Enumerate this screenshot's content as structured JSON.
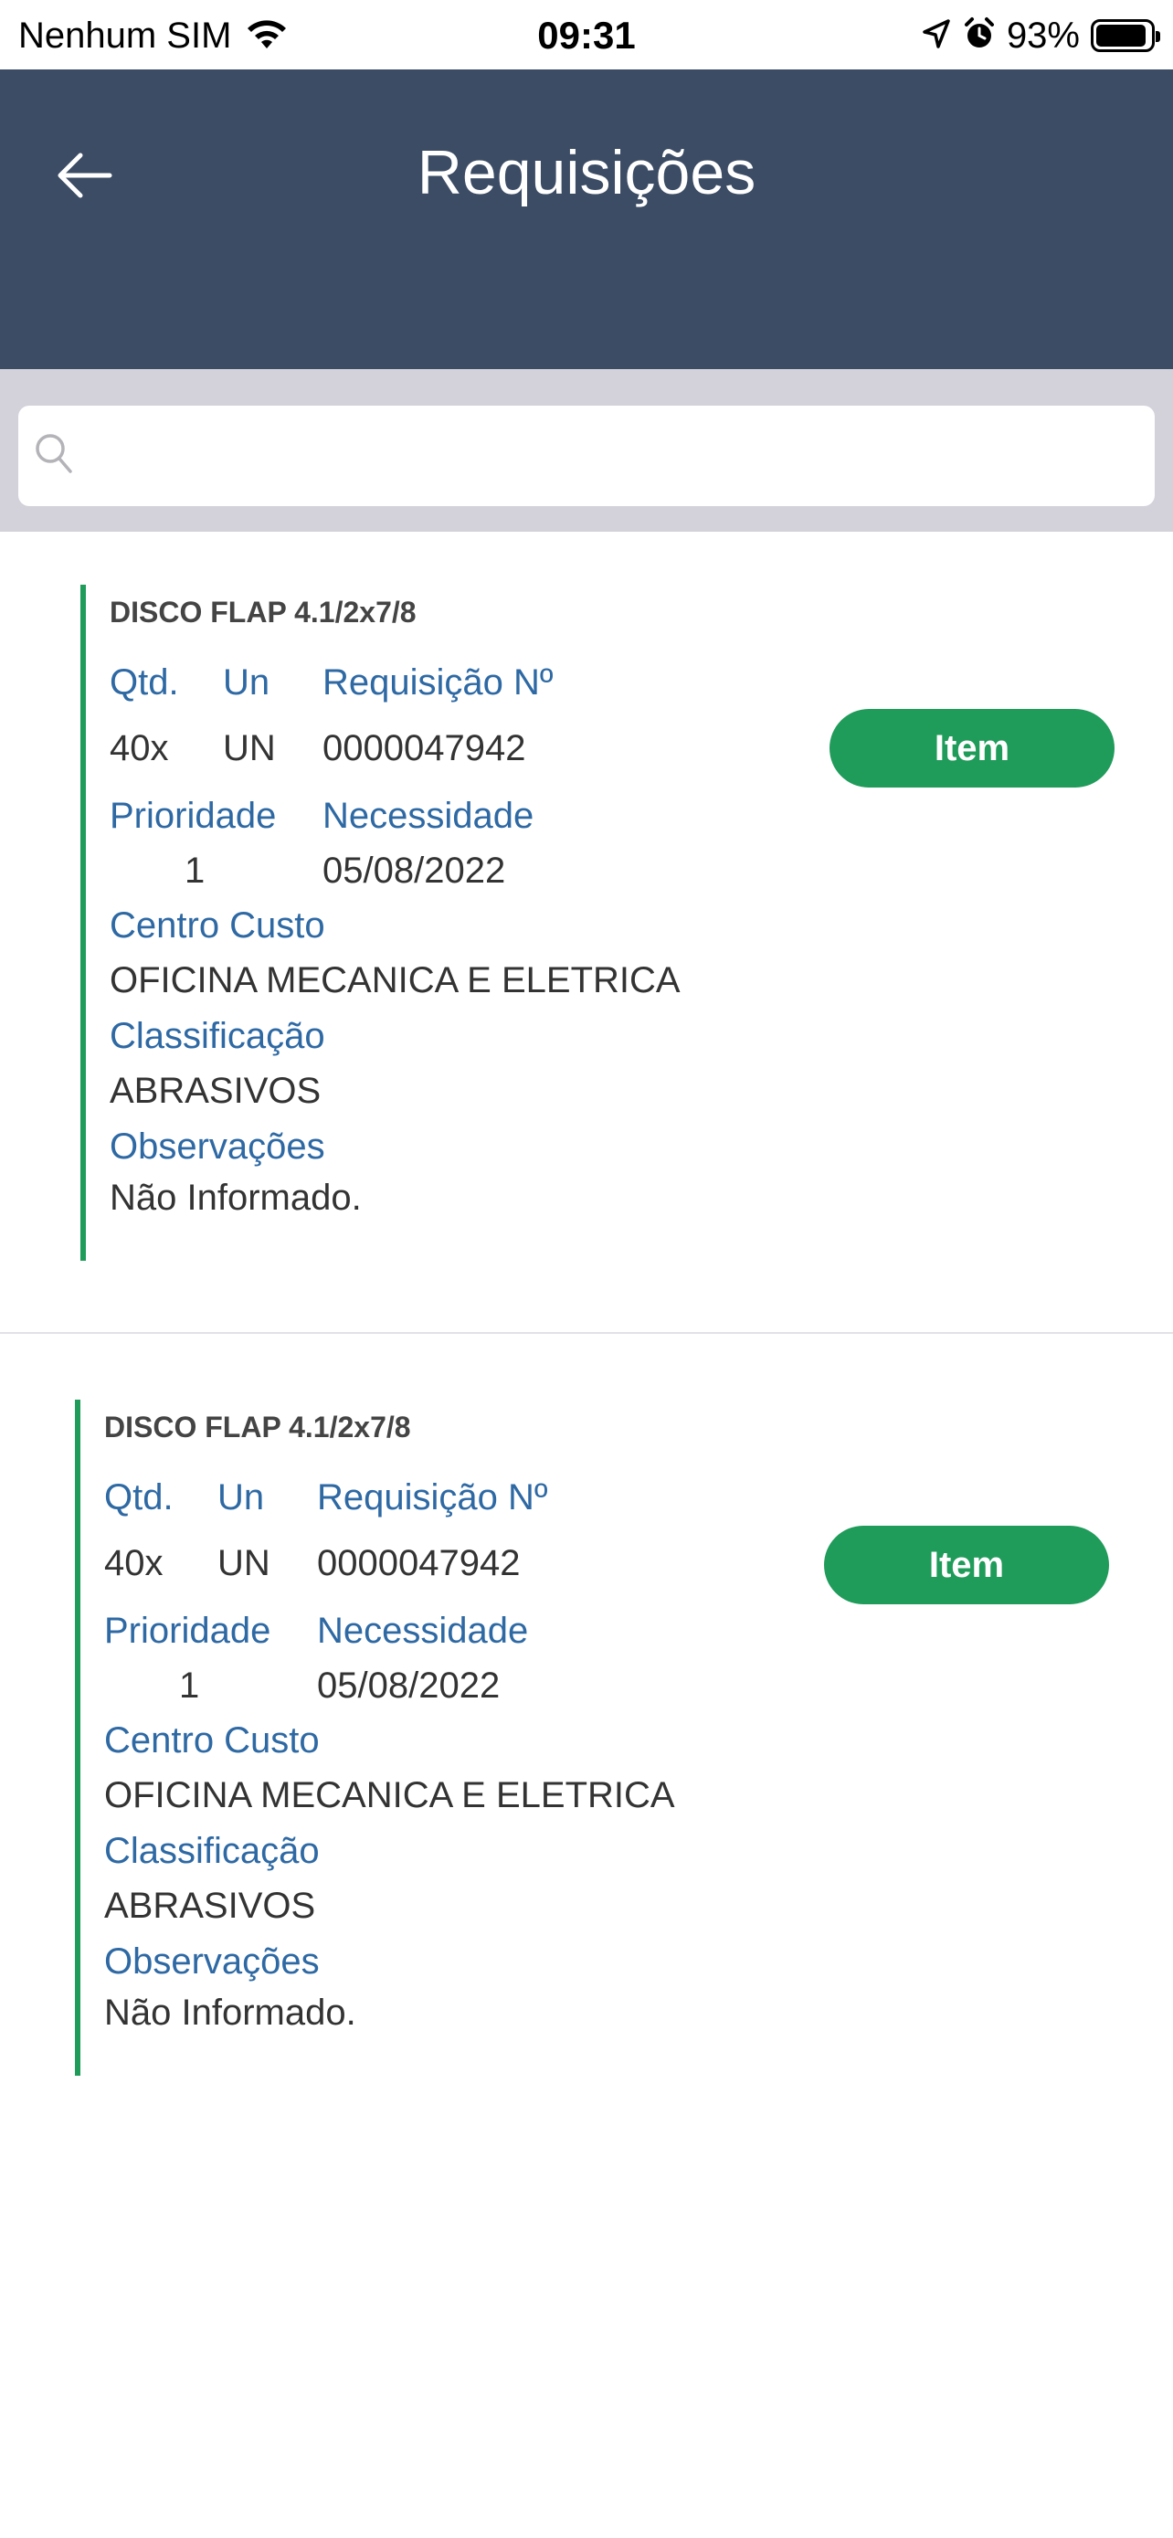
{
  "status_bar": {
    "carrier": "Nenhum SIM",
    "time": "09:31",
    "battery_percent": "93%",
    "battery_level": 0.93
  },
  "header": {
    "title": "Requisições",
    "background": "#3c4c65"
  },
  "search": {
    "placeholder": "",
    "value": ""
  },
  "colors": {
    "accent_green": "#1f9b5a",
    "label_blue": "#2e69a4"
  },
  "requisitions": [
    {
      "product": "DISCO FLAP 4.1/2x7/8",
      "qty_label": "Qtd.",
      "un_label": "Un",
      "req_label": "Requisição Nº",
      "qty": "40x",
      "un": "UN",
      "req_number": "0000047942",
      "priority_label": "Prioridade",
      "need_label": "Necessidade",
      "priority": "1",
      "need_date": "05/08/2022",
      "cost_center_label": "Centro Custo",
      "cost_center": "OFICINA MECANICA E ELETRICA",
      "class_label": "Classificação",
      "classification": "ABRASIVOS",
      "obs_label": "Observações",
      "observations": "Não Informado.",
      "button_label": "Item"
    },
    {
      "product": "DISCO FLAP 4.1/2x7/8",
      "qty_label": "Qtd.",
      "un_label": "Un",
      "req_label": "Requisição Nº",
      "qty": "40x",
      "un": "UN",
      "req_number": "0000047942",
      "priority_label": "Prioridade",
      "need_label": "Necessidade",
      "priority": "1",
      "need_date": "05/08/2022",
      "cost_center_label": "Centro Custo",
      "cost_center": "OFICINA MECANICA E ELETRICA",
      "class_label": "Classificação",
      "classification": "ABRASIVOS",
      "obs_label": "Observações",
      "observations": "Não Informado.",
      "button_label": "Item"
    }
  ]
}
